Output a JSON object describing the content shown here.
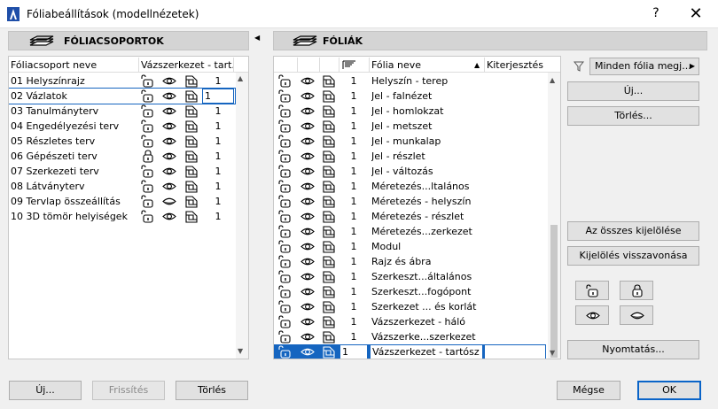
{
  "window": {
    "title": "Fóliabeállítások (modellnézetek)",
    "help_label": "?",
    "close_label": "✕"
  },
  "left": {
    "section_title": "FÓLIACSOPORTOK",
    "col_name": "Fóliacsoport neve",
    "col_model": "Vázszerkezet - tart...",
    "rows": [
      {
        "name": "01 Helyszínrajz",
        "num": "1",
        "lock": "unlocked",
        "eye": "open"
      },
      {
        "name": "02 Vázlatok",
        "num": "1",
        "lock": "unlocked",
        "eye": "open"
      },
      {
        "name": "03 Tanulmányterv",
        "num": "1",
        "lock": "unlocked",
        "eye": "open"
      },
      {
        "name": "04 Engedélyezési terv",
        "num": "1",
        "lock": "unlocked",
        "eye": "open"
      },
      {
        "name": "05 Részletes terv",
        "num": "1",
        "lock": "unlocked",
        "eye": "open"
      },
      {
        "name": "06 Gépészeti terv",
        "num": "1",
        "lock": "locked",
        "eye": "open"
      },
      {
        "name": "07 Szerkezeti terv",
        "num": "1",
        "lock": "unlocked",
        "eye": "open"
      },
      {
        "name": "08 Látványterv",
        "num": "1",
        "lock": "unlocked",
        "eye": "open"
      },
      {
        "name": "09 Tervlap összeállítás",
        "num": "1",
        "lock": "unlocked",
        "eye": "closed"
      },
      {
        "name": "10 3D tömör helyiségek",
        "num": "1",
        "lock": "unlocked",
        "eye": "open"
      }
    ],
    "selected_index": 1,
    "buttons": {
      "new": "Új...",
      "refresh": "Frissítés",
      "delete": "Törlés"
    }
  },
  "right": {
    "section_title": "FÓLIÁK",
    "col_name": "Fólia neve",
    "col_cut": "Kiterjesztés",
    "rows": [
      {
        "name": "Helyszín - terep",
        "num": "1"
      },
      {
        "name": "Jel - falnézet",
        "num": "1"
      },
      {
        "name": "Jel - homlokzat",
        "num": "1"
      },
      {
        "name": "Jel - metszet",
        "num": "1"
      },
      {
        "name": "Jel - munkalap",
        "num": "1"
      },
      {
        "name": "Jel - részlet",
        "num": "1"
      },
      {
        "name": "Jel - változás",
        "num": "1"
      },
      {
        "name": "Méretezés...ltalános",
        "num": "1"
      },
      {
        "name": "Méretezés - helyszín",
        "num": "1"
      },
      {
        "name": "Méretezés - részlet",
        "num": "1"
      },
      {
        "name": "Méretezés...zerkezet",
        "num": "1"
      },
      {
        "name": "Modul",
        "num": "1"
      },
      {
        "name": "Rajz és ábra",
        "num": "1"
      },
      {
        "name": "Szerkeszt...általános",
        "num": "1"
      },
      {
        "name": "Szerkeszt...fogópont",
        "num": "1"
      },
      {
        "name": "Szerkezet ... és korlát",
        "num": "1"
      },
      {
        "name": "Vázszerkezet - háló",
        "num": "1"
      },
      {
        "name": "Vázszerke...szerkezet",
        "num": "1"
      },
      {
        "name": "Vázszerkezet - tartósz",
        "num": "1"
      }
    ],
    "selected_index": 18,
    "filter_label": "Minden fólia megj...",
    "buttons": {
      "new": "Új...",
      "delete": "Törlés...",
      "select_all": "Az összes kijelölése",
      "deselect": "Kijelölés visszavonása",
      "print": "Nyomtatás..."
    }
  },
  "footer": {
    "cancel": "Mégse",
    "ok": "OK"
  },
  "colors": {
    "selection": "#1565c0",
    "section_header": "#d4d4d4"
  }
}
